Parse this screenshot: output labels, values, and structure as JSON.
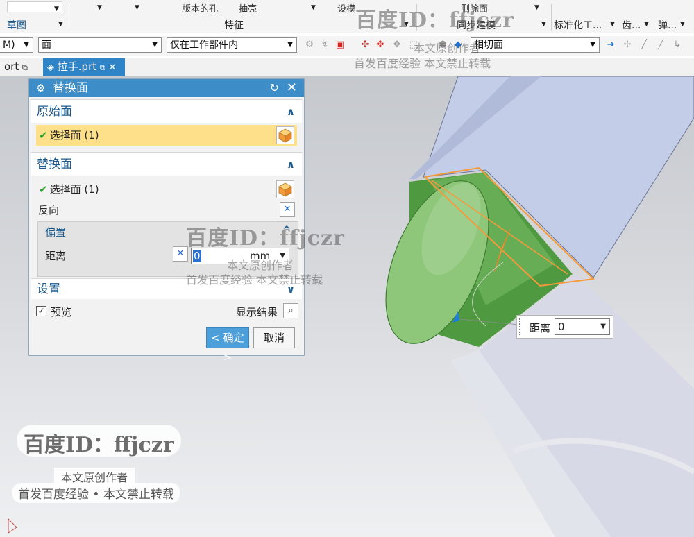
{
  "ribbon": {
    "groups": [
      "草图",
      "特征",
      "同步建模",
      "标准化工...",
      "齿...",
      "弹..."
    ],
    "cut_items": [
      "版本的孔",
      "抽壳",
      "设模",
      "删除面"
    ]
  },
  "toolbar": {
    "combo_left": "M)",
    "face_filter": "面",
    "scope_filter": "仅在工作部件内",
    "tangent_filter": "相切面"
  },
  "tabs": [
    {
      "label": "ort"
    },
    {
      "label": "拉手.prt"
    }
  ],
  "dialog": {
    "title": "替换面",
    "original_face": {
      "header": "原始面",
      "select_label": "选择面 (1)"
    },
    "replacement_face": {
      "header": "替换面",
      "select_label": "选择面 (1)",
      "reverse_label": "反向"
    },
    "offset": {
      "header": "偏置",
      "distance_label": "距离",
      "distance_value": "0",
      "unit": "mm"
    },
    "settings": {
      "header": "设置"
    },
    "preview_label": "预览",
    "show_result_label": "显示结果",
    "ok_label": "< 确定 >",
    "cancel_label": "取消"
  },
  "float_distance": {
    "label": "距离",
    "value": "0"
  },
  "watermarks": {
    "id_text": "百度ID：ffjczr",
    "author_text": "本文原创作者",
    "copyright_text": "首发百度经验  本文禁止转载",
    "copyright_text_card": "首发百度经验 • 本文禁止转载"
  },
  "colors": {
    "accent": "#3c8dc8",
    "highlight": "#ffe08a",
    "cylinder": "#5fa84e",
    "block": "#c3cde8",
    "edge_highlight": "#f59a3c"
  }
}
